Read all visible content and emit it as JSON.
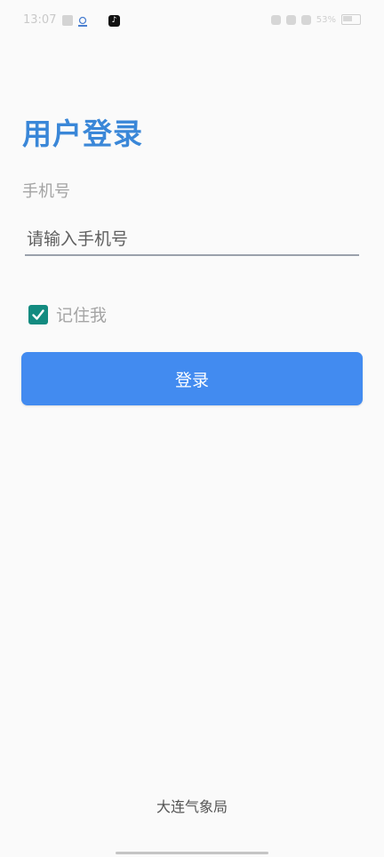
{
  "status_bar": {
    "time": "13:07",
    "battery": "53%",
    "icons": [
      "message-icon",
      "app-icon",
      "tiktok-icon",
      "alarm-icon",
      "signal-icon",
      "wifi-icon",
      "battery-icon"
    ]
  },
  "login": {
    "title": "用户登录",
    "phone_label": "手机号",
    "phone_placeholder": "请输入手机号",
    "phone_value": "",
    "remember_label": "记住我",
    "remember_checked": true,
    "submit_label": "登录"
  },
  "footer": {
    "text": "大连气象局"
  },
  "colors": {
    "accent": "#3a87d8",
    "button": "#428bf0",
    "checkbox": "#138b80",
    "background": "#fafafa"
  }
}
